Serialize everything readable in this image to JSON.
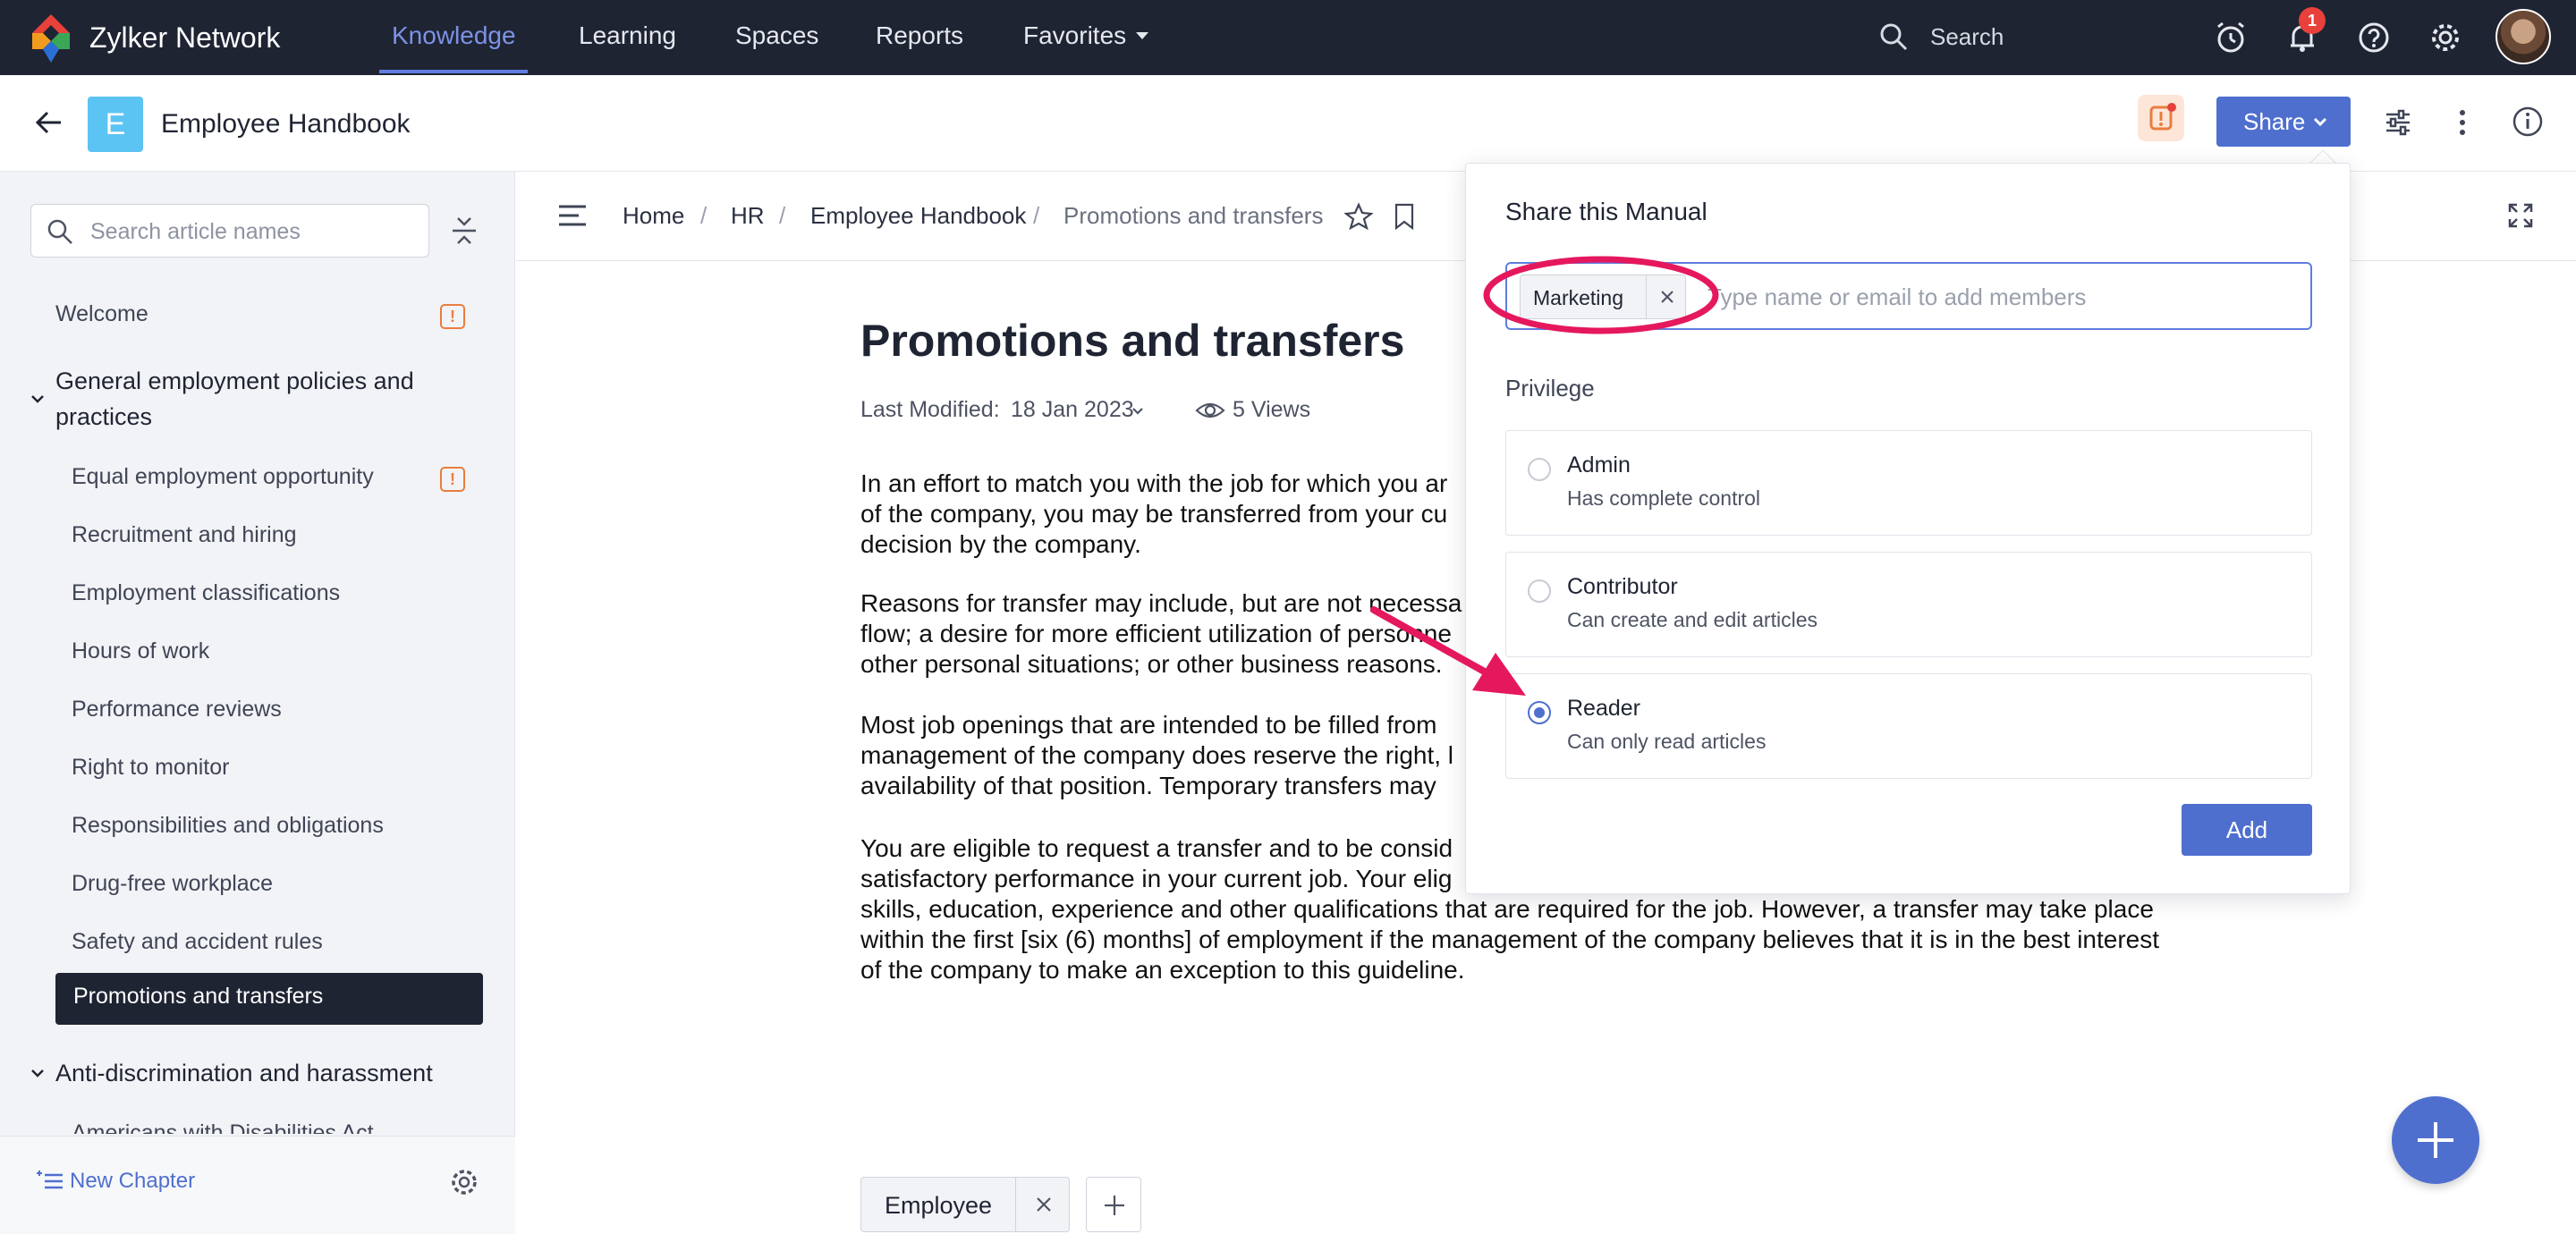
{
  "topnav": {
    "brand": "Zylker Network",
    "items": [
      "Knowledge",
      "Learning",
      "Spaces",
      "Reports",
      "Favorites"
    ],
    "search_label": "Search",
    "notification_count": "1"
  },
  "header": {
    "initial": "E",
    "title": "Employee Handbook",
    "share_label": "Share"
  },
  "sidebar": {
    "search_placeholder": "Search article names",
    "items": [
      "Welcome",
      "General employment policies and practices",
      "Equal employment opportunity",
      "Recruitment and hiring",
      "Employment classifications",
      "Hours of work",
      "Performance reviews",
      "Right to monitor",
      "Responsibilities and obligations",
      "Drug-free workplace",
      "Safety and accident rules",
      "Promotions and transfers",
      "Anti-discrimination and harassment",
      "Americans with Disabilities Act"
    ],
    "new_chapter": "New Chapter"
  },
  "breadcrumb": [
    "Home",
    "HR",
    "Employee Handbook",
    "Promotions and transfers"
  ],
  "article": {
    "title": "Promotions and transfers",
    "modified_label": "Last Modified:",
    "modified_date": "18 Jan 2023",
    "views": "5 Views",
    "paragraphs": [
      [
        "In an effort to match you with the job for which you ar",
        "of the company, you may be transferred from your cu",
        "decision by the company."
      ],
      [
        "Reasons for transfer may include, but are not necessa",
        "flow; a desire for more efficient utilization of personne",
        "other personal situations; or other business reasons."
      ],
      [
        "Most job openings that are intended to be filled from",
        "management of the company does reserve the right, l",
        "availability of that position. Temporary transfers may"
      ],
      [
        "You are eligible to request a transfer and to be consid",
        "satisfactory performance in your current job. Your elig",
        "skills, education, experience and other qualifications that are required for the job. However, a transfer may take place",
        "within the first [six (6) months] of employment if the management of the company believes that it is in the best interest",
        "of the company to make an exception to this guideline."
      ]
    ],
    "tag": "Employee"
  },
  "share_popover": {
    "title": "Share this Manual",
    "chip": "Marketing",
    "input_placeholder": "Type name or email to add members",
    "privilege_label": "Privilege",
    "options": [
      {
        "name": "Admin",
        "desc": "Has complete control",
        "selected": false
      },
      {
        "name": "Contributor",
        "desc": "Can create and edit articles",
        "selected": false
      },
      {
        "name": "Reader",
        "desc": "Can only read articles",
        "selected": true
      }
    ],
    "add_label": "Add"
  },
  "colors": {
    "nav_bg": "#1f2433",
    "accent": "#4f6fcf",
    "annotation": "#e5185d",
    "warning": "#e97d3e"
  }
}
